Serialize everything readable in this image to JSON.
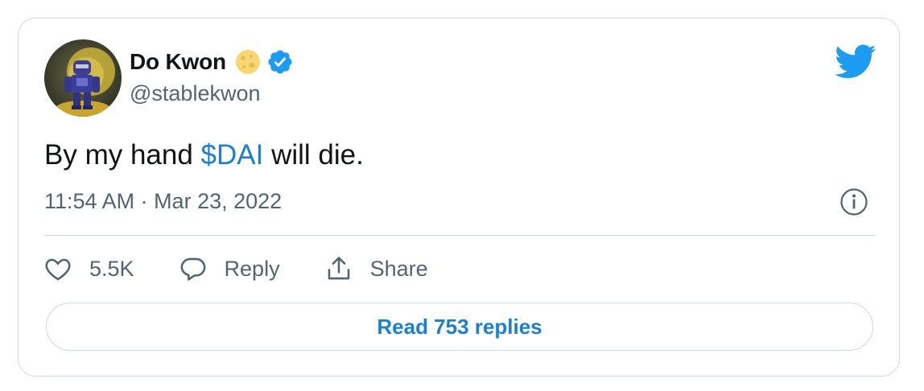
{
  "author": {
    "display_name": "Do Kwon",
    "handle": "@stablekwon",
    "verified": true,
    "avatar_icon": "robot-avatar",
    "name_emoji": "full-moon-icon"
  },
  "tweet": {
    "text_before": "By my hand ",
    "cashtag": "$DAI",
    "text_after": " will die.",
    "timestamp": "11:54 AM · Mar 23, 2022"
  },
  "actions": {
    "like_count": "5.5K",
    "reply_label": "Reply",
    "share_label": "Share"
  },
  "footer": {
    "read_replies_label": "Read 753 replies"
  },
  "colors": {
    "accent": "#1d7fd0",
    "twitter_blue": "#1d9bf0",
    "muted_text": "#536471",
    "border": "#cfd9de"
  }
}
